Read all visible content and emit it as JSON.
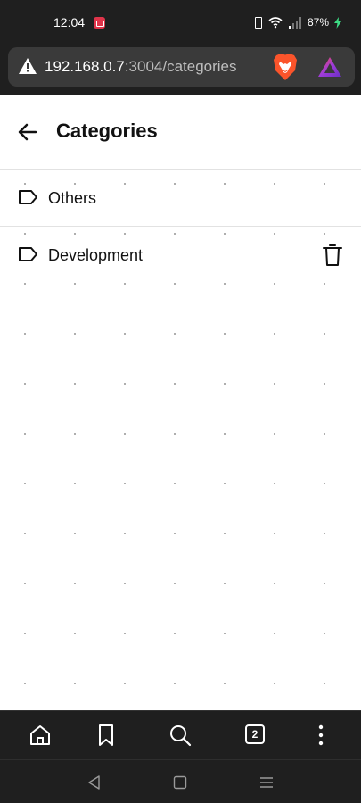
{
  "status_bar": {
    "time": "12:04",
    "battery": "87%",
    "icons": [
      "screen-record-icon",
      "vibrate-icon",
      "wifi-icon",
      "signal-icon",
      "charging-bolt-icon"
    ]
  },
  "browser": {
    "url_host": "192.168.0.7",
    "url_path": ":3004/categories",
    "icons": [
      "warning-icon",
      "brave-lion-icon",
      "brave-rewards-icon"
    ],
    "tab_count": "2",
    "bottom_icons": [
      "home-icon",
      "bookmark-icon",
      "search-icon",
      "tabs-icon",
      "more-icon"
    ]
  },
  "page": {
    "title": "Categories",
    "categories": [
      {
        "label": "Others",
        "deletable": false
      },
      {
        "label": "Development",
        "deletable": true
      }
    ]
  },
  "system_nav": {
    "icons": [
      "back-triangle-icon",
      "home-square-icon",
      "recents-icon"
    ]
  },
  "colors": {
    "chrome_bg": "#1f1f1f",
    "url_bar_bg": "#3a3a3a",
    "page_bg": "#ffffff",
    "accent_recording": "#e0344a",
    "charging": "#3ddc84"
  }
}
